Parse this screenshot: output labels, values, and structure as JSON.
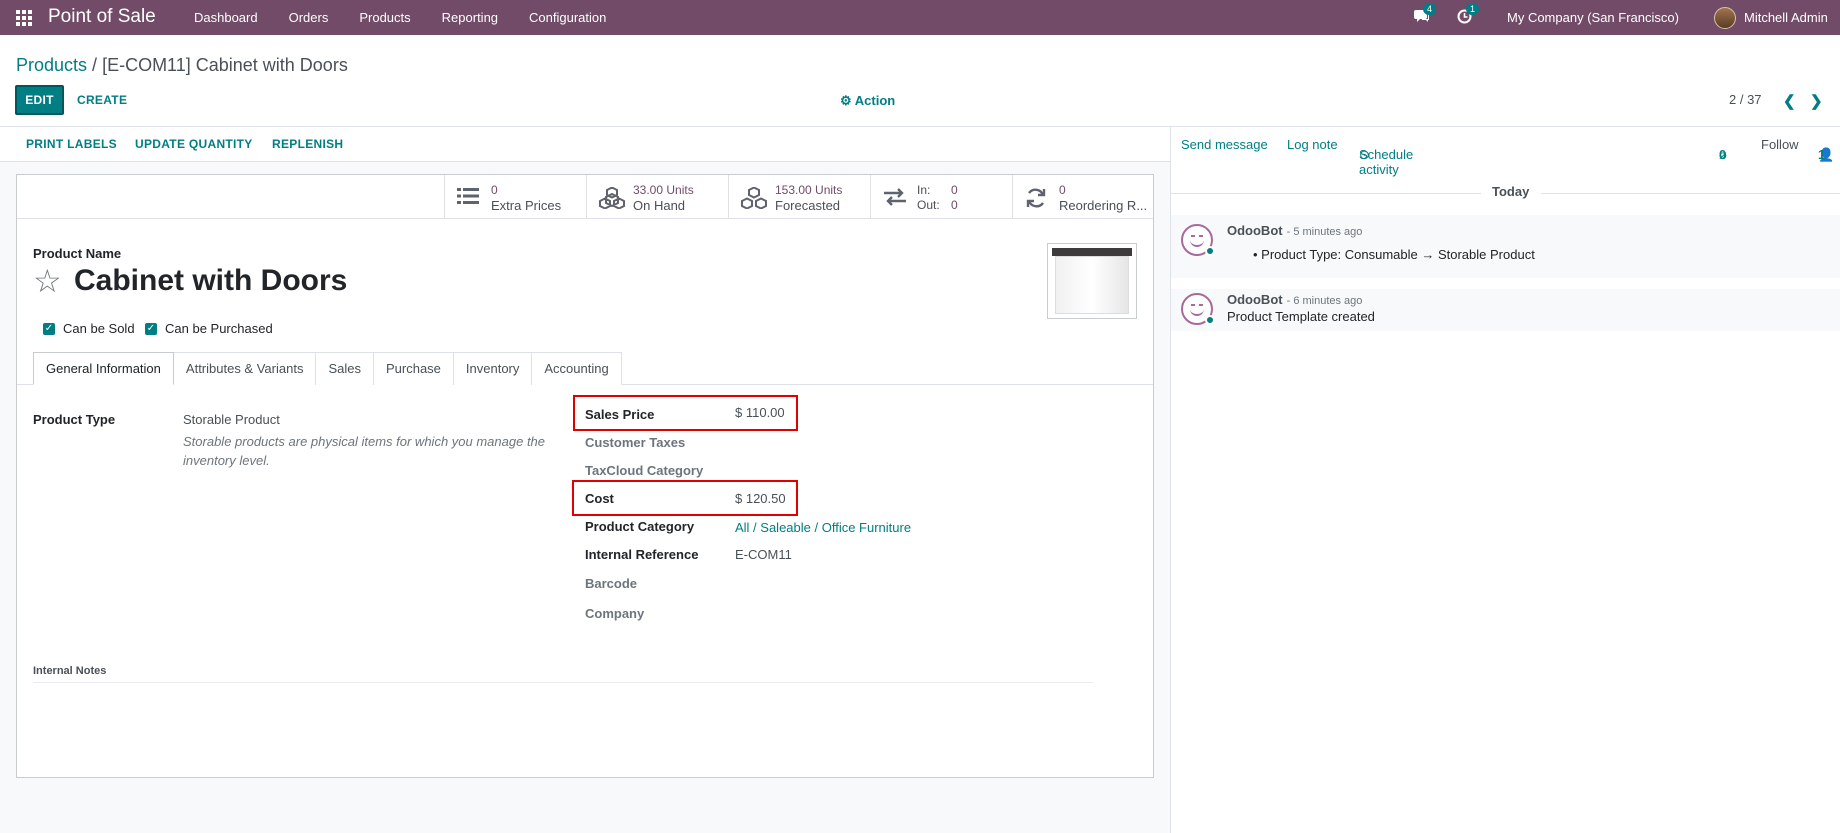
{
  "navbar": {
    "app_name": "Point of Sale",
    "menu": [
      "Dashboard",
      "Orders",
      "Products",
      "Reporting",
      "Configuration"
    ],
    "messages_count": "4",
    "activities_count": "1",
    "company": "My Company (San Francisco)",
    "user": "Mitchell Admin"
  },
  "breadcrumb": {
    "parent": "Products",
    "separator": " / ",
    "current": "[E-COM11] Cabinet with Doors"
  },
  "control": {
    "edit_label": "EDIT",
    "create_label": "CREATE",
    "action_label": "Action",
    "pager": "2 / 37"
  },
  "statusbar": {
    "print_labels": "PRINT LABELS",
    "update_quantity": "UPDATE QUANTITY",
    "replenish": "REPLENISH"
  },
  "smart_buttons": {
    "extra_prices": {
      "value": "0",
      "label": "Extra Prices"
    },
    "on_hand": {
      "value": "33.00 Units",
      "label": "On Hand"
    },
    "forecasted": {
      "value": "153.00 Units",
      "label": "Forecasted"
    },
    "in_out": {
      "in_label": "In:",
      "in_value": "0",
      "out_label": "Out:",
      "out_value": "0"
    },
    "reordering": {
      "value": "0",
      "label": "Reordering R..."
    }
  },
  "product": {
    "name_label": "Product Name",
    "name": "Cabinet with Doors",
    "can_be_sold": "Can be Sold",
    "can_be_purchased": "Can be Purchased"
  },
  "tabs": [
    "General Information",
    "Attributes & Variants",
    "Sales",
    "Purchase",
    "Inventory",
    "Accounting"
  ],
  "fields": {
    "product_type_label": "Product Type",
    "product_type": "Storable Product",
    "product_type_help": "Storable products are physical items for which you manage the inventory level.",
    "sales_price_label": "Sales Price",
    "sales_price": "$ 110.00",
    "customer_taxes_label": "Customer Taxes",
    "taxcloud_label": "TaxCloud Category",
    "cost_label": "Cost",
    "cost": "$ 120.50",
    "category_label": "Product Category",
    "category": "All / Saleable / Office Furniture",
    "internal_ref_label": "Internal Reference",
    "internal_ref": "E-COM11",
    "barcode_label": "Barcode",
    "company_label": "Company",
    "internal_notes_label": "Internal Notes"
  },
  "chatter": {
    "send_message": "Send message",
    "log_note": "Log note",
    "schedule_activity": "Schedule activity",
    "attachments": "0",
    "follow": "Follow",
    "followers": "1",
    "today": "Today",
    "messages": [
      {
        "author": "OdooBot",
        "time": "- 5 minutes ago",
        "body": "Product Type: Consumable → Storable Product"
      },
      {
        "author": "OdooBot",
        "time": "- 6 minutes ago",
        "body": "Product Template created"
      }
    ]
  }
}
